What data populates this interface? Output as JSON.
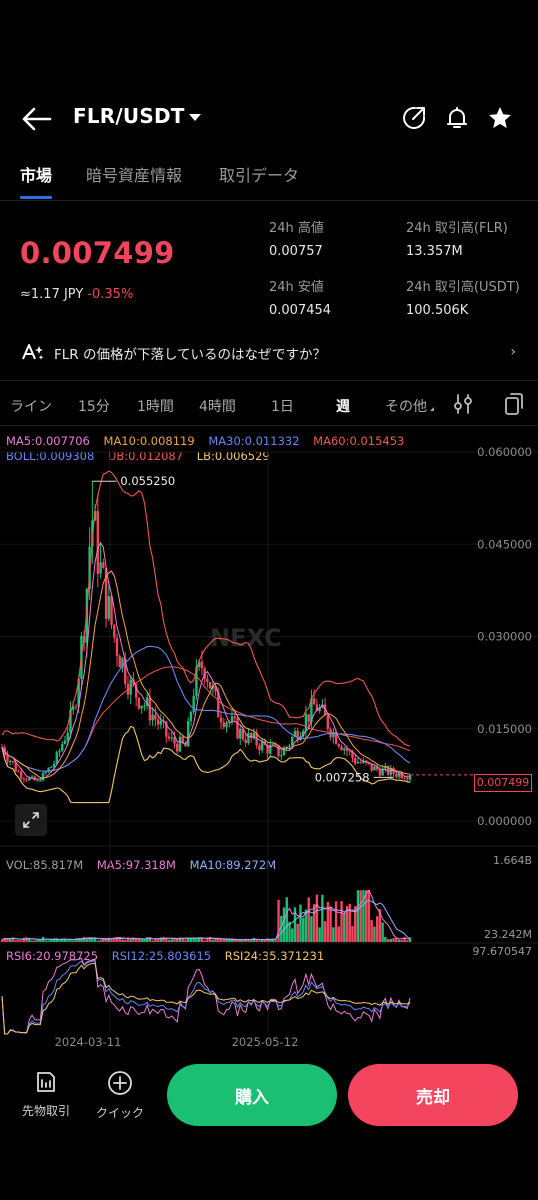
{
  "header": {
    "pair": "FLR/USDT"
  },
  "tabs": [
    "市場",
    "暗号資産情報",
    "取引データ"
  ],
  "ticker": {
    "price": "0.007499",
    "fiat": "≈1.17 JPY",
    "change": "-0.35%",
    "high_label": "24h 高値",
    "high": "0.00757",
    "low_label": "24h 安値",
    "low": "0.007454",
    "vol_base_label": "24h 取引高(FLR)",
    "vol_base": "13.357M",
    "vol_quote_label": "24h 取引高(USDT)",
    "vol_quote": "100.506K"
  },
  "ai_question": "FLR の価格が下落しているのはなぜですか？",
  "timeframes": [
    "ライン",
    "15分",
    "1時間",
    "4時間",
    "1日",
    "週",
    "その他"
  ],
  "legend": {
    "ma5": "MA5:0.007706",
    "ma10": "MA10:0.008119",
    "ma30": "MA30:0.011332",
    "ma60": "MA60:0.015453",
    "boll": "BOLL:0.009308",
    "ub": "UB:0.012087",
    "lb": "LB:0.006529",
    "vol": "VOL:85.817M",
    "vma5": "MA5:97.318M",
    "vma10": "MA10:89.272M",
    "rsi6": "RSI6:20.978725",
    "rsi12": "RSI12:25.803615",
    "rsi24": "RSI24:35.371231"
  },
  "colors": {
    "up": "#1abf74",
    "down": "#f4455e",
    "ma5": "#e77fd6",
    "ma10": "#f2a541",
    "ma30": "#6a86f0",
    "ma60": "#f0584f",
    "accent": "#2f6fe0"
  },
  "chart_data": {
    "type": "candlestick",
    "price_axis": [
      "0.060000",
      "0.045000",
      "0.030000",
      "0.015000",
      "0.000000"
    ],
    "price_axis_values": [
      0.06,
      0.045,
      0.03,
      0.015,
      0.0
    ],
    "max_label": "0.055250",
    "max_value": 0.05525,
    "min_label": "0.007258",
    "min_value": 0.007258,
    "last_price_label": "0.007499",
    "last_price": 0.007499,
    "volume_axis": [
      "1.664B",
      "23.242M"
    ],
    "rsi_axis": [
      "97.670547"
    ],
    "x_labels": [
      "2024-03-11",
      "2025-05-12"
    ],
    "watermark": "NEXC"
  },
  "bottom": {
    "futures": "先物取引",
    "quick": "クイック",
    "buy": "購入",
    "sell": "売却"
  }
}
